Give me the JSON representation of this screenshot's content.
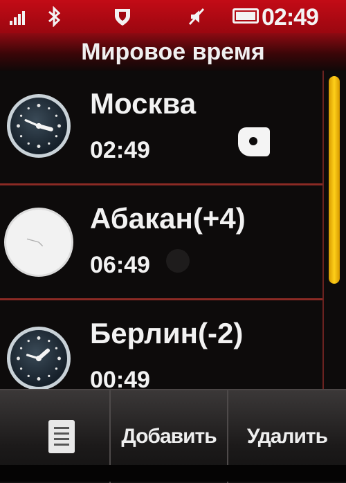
{
  "status_bar": {
    "time": "02:49",
    "icons": [
      "signal-icon",
      "bluetooth-icon",
      "shield-icon",
      "volume-icon",
      "battery-icon"
    ]
  },
  "title": "Мировое время",
  "cities": [
    {
      "name": "Москва",
      "time": "02:49",
      "clock_style": "dark",
      "home": true
    },
    {
      "name": "Абакан(+4)",
      "time": "06:49",
      "clock_style": "light",
      "home": false
    },
    {
      "name": "Берлин(-2)",
      "time": "00:49",
      "clock_style": "dark",
      "home": false
    }
  ],
  "softkeys": {
    "menu_icon": "menu-icon",
    "add_label": "Добавить",
    "delete_label": "Удалить"
  },
  "colors": {
    "status_bar": "#c30b16",
    "divider": "#8a2a24",
    "scroll_thumb": "#ffcf1a"
  }
}
